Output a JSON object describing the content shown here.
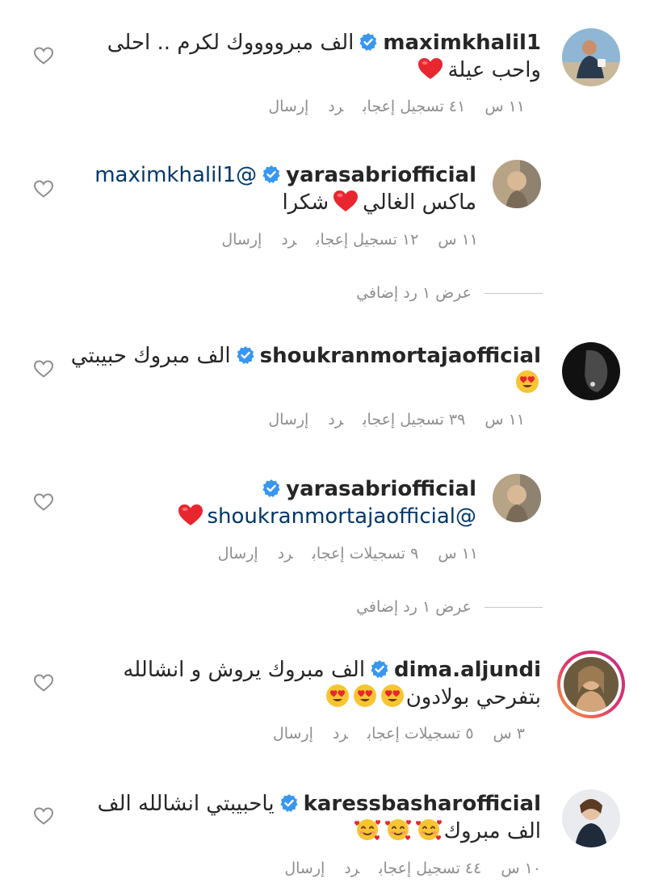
{
  "comments": [
    {
      "username": "maxim‎khalil1",
      "text_line1": "الف مبرووووك لكرم .. احلى",
      "text_line2": "واحب عيلة",
      "time": "١١ س",
      "likes": "٤١ تسجيل إعجاب",
      "reply": "رد",
      "send": "إرسال"
    },
    {
      "username": "yarasabriofficial",
      "mention": "maximkhalil1@",
      "text_line1": "ماكس الغالي",
      "text_line1b": "شكرا",
      "time": "١١ س",
      "likes": "١٢ تسجيل إعجاب",
      "reply": "رد",
      "send": "إرسال"
    },
    {
      "username": "shoukranmortajaofficial",
      "text_line1": "الف مبروك حبيبتي",
      "time": "١١ س",
      "likes": "٣٩ تسجيل إعجاب",
      "reply": "رد",
      "send": "إرسال"
    },
    {
      "username": "yarasabriofficial",
      "mention": "shoukranmortajaofficial@",
      "time": "١١ س",
      "likes": "٩ تسجيلات إعجاب",
      "reply": "رد",
      "send": "إرسال"
    },
    {
      "username": "dima.aljundi",
      "text_line1": "الف مبروك يروش و انشالله",
      "text_line2": "بتفرحي بولادون",
      "time": "٣ س",
      "likes": "٥ تسجيلات إعجاب",
      "reply": "رد",
      "send": "إرسال"
    },
    {
      "username": "karessbasharofficial",
      "text_line1": "ياحبيبتي انشالله الف",
      "text_line2": "الف مبروك",
      "time": "١٠ س",
      "likes": "٤٤ تسجيل إعجاب",
      "reply": "رد",
      "send": "إرسال"
    }
  ],
  "view_replies": [
    {
      "label": "عرض ١ رد إضافي"
    },
    {
      "label": "عرض ١ رد إضافي"
    }
  ],
  "colors": {
    "text": "#262626",
    "meta": "#8e8e8e",
    "mention": "#00376b",
    "verified": "#3897f0",
    "heart": "#ed4956"
  }
}
